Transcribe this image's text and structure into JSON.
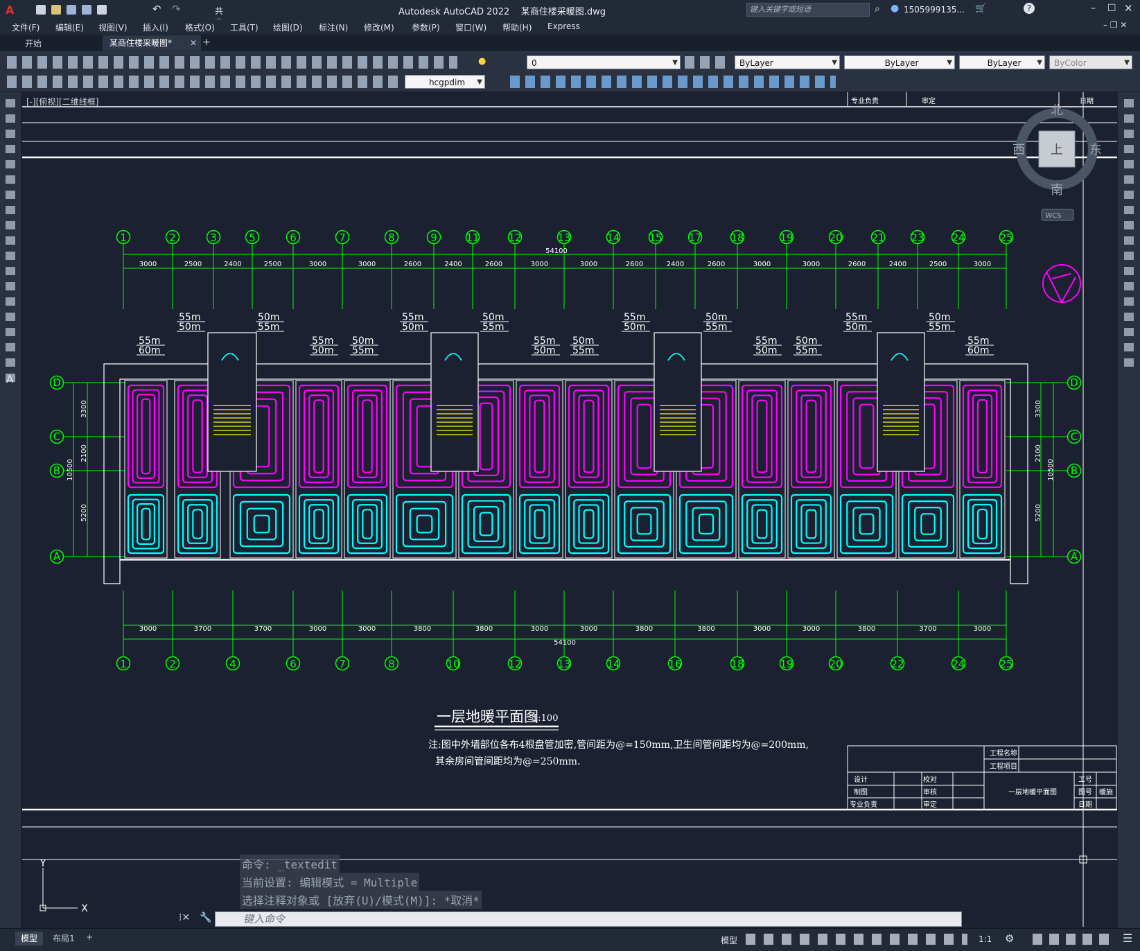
{
  "app": {
    "title": "Autodesk AutoCAD 2022",
    "file": "某商住楼采暖图.dwg",
    "search_placeholder": "键入关键字或短语",
    "user": "1505999135...",
    "share": "共享"
  },
  "menu": [
    "文件(F)",
    "编辑(E)",
    "视图(V)",
    "插入(I)",
    "格式(O)",
    "工具(T)",
    "绘图(D)",
    "标注(N)",
    "修改(M)",
    "参数(P)",
    "窗口(W)",
    "帮助(H)",
    "Express"
  ],
  "tabs": {
    "start": "开始",
    "active": "某商住楼采暖图*"
  },
  "toolbar": {
    "layer": "0",
    "color": "ByLayer",
    "linetype": "ByLayer",
    "lineweight": "ByLayer",
    "plotstyle": "ByColor",
    "dimstyle": "hcgpdim"
  },
  "viewport_label": "[-][俯视][二维线框]",
  "viewcube": {
    "north": "北",
    "south": "南",
    "east": "东",
    "west": "西",
    "face": "上",
    "wcs": "WCS"
  },
  "axes_top": [
    "1",
    "2",
    "3",
    "5",
    "6",
    "7",
    "8",
    "9",
    "11",
    "12",
    "13",
    "14",
    "15",
    "17",
    "18",
    "19",
    "20",
    "21",
    "23",
    "24",
    "25"
  ],
  "dims_top": [
    "3000",
    "2500",
    "2400",
    "2500",
    "3000",
    "3000",
    "2600",
    "2400",
    "2600",
    "3000",
    "3000",
    "2600",
    "2400",
    "2600",
    "3000",
    "3000",
    "2600",
    "2400",
    "2500",
    "3000"
  ],
  "total_top": "54100",
  "axes_bottom": [
    "1",
    "2",
    "4",
    "6",
    "7",
    "8",
    "10",
    "12",
    "13",
    "14",
    "16",
    "18",
    "19",
    "20",
    "22",
    "24",
    "25"
  ],
  "dims_bottom": [
    "3000",
    "3700",
    "3700",
    "3000",
    "3000",
    "3800",
    "3800",
    "3000",
    "3000",
    "3800",
    "3800",
    "3000",
    "3000",
    "3800",
    "3700",
    "3000"
  ],
  "total_bottom": "54100",
  "axes_rows": [
    "D",
    "C",
    "B",
    "A"
  ],
  "dims_left": [
    "3300",
    "2100",
    "5200"
  ],
  "total_left": "10500",
  "pipe_labels": {
    "a": "55m",
    "b": "60m",
    "c": "50m"
  },
  "drawing_title": "一层地暖平面图",
  "drawing_scale": "1:100",
  "note_line1": "注:图中外墙部位各布4根盘管加密,管间距为@=150mm,卫生间管间距均为@=200mm,",
  "note_line2": "其余房间管间距均为@=250mm.",
  "titleblock": {
    "project_name": "工程名称",
    "project_item": "工程项目",
    "design": "设计",
    "draw": "制图",
    "major": "专业负责",
    "proofread": "校对",
    "review": "审核",
    "approve": "审定",
    "drawing_name": "一层地暖平面图",
    "work_no": "工号",
    "fig_no": "图号",
    "date": "日期",
    "pipe": "暖施"
  },
  "commands": [
    "命令: _textedit",
    "当前设置: 编辑模式 = Multiple",
    "选择注释对象或 [放弃(U)/模式(M)]: *取消*"
  ],
  "command_placeholder": "键入命令",
  "layout_tabs": [
    "模型",
    "布局1"
  ],
  "status": {
    "model": "模型",
    "scale": "1:1"
  },
  "colors": {
    "axis": "#00ff00",
    "hot_pipe": "#ff00ff",
    "cold_pipe": "#00ffff",
    "wall": "#ffffff",
    "stair": "#ffff00",
    "bg": "#1b2130"
  }
}
